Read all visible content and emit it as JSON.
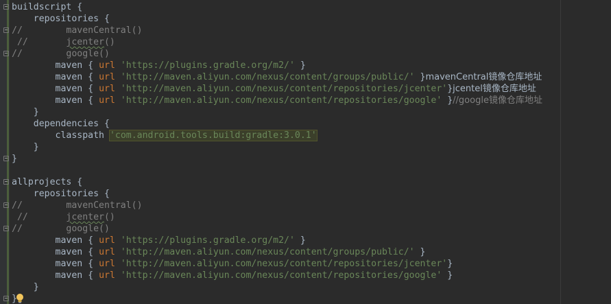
{
  "editor": {
    "language": "gradle",
    "bulb_icon": "lightbulb-icon",
    "lines": [
      {
        "fold": "open",
        "indent": "",
        "tokens": [
          {
            "t": "buildscript {",
            "c": "plain"
          }
        ]
      },
      {
        "fold": "",
        "indent": "    ",
        "tokens": [
          {
            "t": "repositories {",
            "c": "plain"
          }
        ]
      },
      {
        "fold": "open",
        "indent": "",
        "tokens": [
          {
            "t": "//",
            "c": "cm"
          },
          {
            "t": "        mavenCentral()",
            "c": "cm-text"
          }
        ]
      },
      {
        "fold": "",
        "indent": "",
        "tokens": [
          {
            "t": " //",
            "c": "cm"
          },
          {
            "t": "       ",
            "c": "cm-text"
          },
          {
            "t": "jcenter",
            "c": "cm-text wavy"
          },
          {
            "t": "()",
            "c": "cm-text"
          }
        ]
      },
      {
        "fold": "close",
        "indent": "",
        "tokens": [
          {
            "t": "//",
            "c": "cm"
          },
          {
            "t": "        google()",
            "c": "cm-text"
          }
        ]
      },
      {
        "fold": "",
        "indent": "        ",
        "tokens": [
          {
            "t": "maven { ",
            "c": "plain"
          },
          {
            "t": "url",
            "c": "kw"
          },
          {
            "t": " ",
            "c": "plain"
          },
          {
            "t": "'https://plugins.gradle.org/m2/'",
            "c": "str"
          },
          {
            "t": " }",
            "c": "plain"
          }
        ]
      },
      {
        "fold": "",
        "indent": "        ",
        "tokens": [
          {
            "t": "maven { ",
            "c": "plain"
          },
          {
            "t": "url",
            "c": "kw"
          },
          {
            "t": " ",
            "c": "plain"
          },
          {
            "t": "'http://maven.aliyun.com/nexus/content/groups/public/'",
            "c": "str"
          },
          {
            "t": " }",
            "c": "plain"
          },
          {
            "t": "mavenCentral镜像仓库地址",
            "c": "zh"
          }
        ]
      },
      {
        "fold": "",
        "indent": "        ",
        "tokens": [
          {
            "t": "maven { ",
            "c": "plain"
          },
          {
            "t": "url",
            "c": "kw"
          },
          {
            "t": " ",
            "c": "plain"
          },
          {
            "t": "'http://maven.aliyun.com/nexus/content/repositories/jcenter'",
            "c": "str"
          },
          {
            "t": "}",
            "c": "plain"
          },
          {
            "t": "jcentel镜像仓库地址",
            "c": "zh"
          }
        ]
      },
      {
        "fold": "",
        "indent": "        ",
        "tokens": [
          {
            "t": "maven { ",
            "c": "plain"
          },
          {
            "t": "url",
            "c": "kw"
          },
          {
            "t": " ",
            "c": "plain"
          },
          {
            "t": "'http://maven.aliyun.com/nexus/content/repositories/google'",
            "c": "str"
          },
          {
            "t": " }",
            "c": "plain"
          },
          {
            "t": "//google镜像仓库地址",
            "c": "zh-cm"
          }
        ]
      },
      {
        "fold": "",
        "indent": "    ",
        "tokens": [
          {
            "t": "}",
            "c": "plain"
          }
        ]
      },
      {
        "fold": "",
        "indent": "    ",
        "tokens": [
          {
            "t": "dependencies {",
            "c": "plain"
          }
        ]
      },
      {
        "fold": "",
        "indent": "        ",
        "tokens": [
          {
            "t": "classpath ",
            "c": "plain"
          },
          {
            "t": "'com.android.tools.build:gradle:3.0.1'",
            "c": "str-hl"
          }
        ]
      },
      {
        "fold": "",
        "indent": "    ",
        "tokens": [
          {
            "t": "}",
            "c": "plain"
          }
        ]
      },
      {
        "fold": "close",
        "indent": "",
        "tokens": [
          {
            "t": "}",
            "c": "plain"
          }
        ]
      },
      {
        "fold": "",
        "indent": "",
        "tokens": []
      },
      {
        "fold": "open",
        "indent": "",
        "tokens": [
          {
            "t": "allprojects {",
            "c": "plain"
          }
        ]
      },
      {
        "fold": "",
        "indent": "    ",
        "tokens": [
          {
            "t": "repositories {",
            "c": "plain"
          }
        ]
      },
      {
        "fold": "open",
        "indent": "",
        "tokens": [
          {
            "t": "//",
            "c": "cm"
          },
          {
            "t": "        mavenCentral()",
            "c": "cm-text"
          }
        ]
      },
      {
        "fold": "",
        "indent": "",
        "tokens": [
          {
            "t": " //",
            "c": "cm"
          },
          {
            "t": "       ",
            "c": "cm-text"
          },
          {
            "t": "jcenter",
            "c": "cm-text wavy"
          },
          {
            "t": "()",
            "c": "cm-text"
          }
        ]
      },
      {
        "fold": "close",
        "indent": "",
        "tokens": [
          {
            "t": "//",
            "c": "cm"
          },
          {
            "t": "        google()",
            "c": "cm-text"
          }
        ]
      },
      {
        "fold": "",
        "indent": "        ",
        "tokens": [
          {
            "t": "maven { ",
            "c": "plain"
          },
          {
            "t": "url",
            "c": "kw"
          },
          {
            "t": " ",
            "c": "plain"
          },
          {
            "t": "'https://plugins.gradle.org/m2/'",
            "c": "str"
          },
          {
            "t": " }",
            "c": "plain"
          }
        ]
      },
      {
        "fold": "",
        "indent": "        ",
        "tokens": [
          {
            "t": "maven { ",
            "c": "plain"
          },
          {
            "t": "url",
            "c": "kw"
          },
          {
            "t": " ",
            "c": "plain"
          },
          {
            "t": "'http://maven.aliyun.com/nexus/content/groups/public/'",
            "c": "str"
          },
          {
            "t": " }",
            "c": "plain"
          }
        ]
      },
      {
        "fold": "",
        "indent": "        ",
        "tokens": [
          {
            "t": "maven { ",
            "c": "plain"
          },
          {
            "t": "url",
            "c": "kw"
          },
          {
            "t": " ",
            "c": "plain"
          },
          {
            "t": "'http://maven.aliyun.com/nexus/content/repositories/jcenter'",
            "c": "str"
          },
          {
            "t": "}",
            "c": "plain"
          }
        ]
      },
      {
        "fold": "",
        "indent": "        ",
        "tokens": [
          {
            "t": "maven { ",
            "c": "plain"
          },
          {
            "t": "url",
            "c": "kw"
          },
          {
            "t": " ",
            "c": "plain"
          },
          {
            "t": "'http://maven.aliyun.com/nexus/content/repositories/google'",
            "c": "str"
          },
          {
            "t": " }",
            "c": "plain"
          }
        ]
      },
      {
        "fold": "",
        "indent": "    ",
        "tokens": [
          {
            "t": "}",
            "c": "plain"
          }
        ]
      },
      {
        "fold": "close",
        "indent": "",
        "tokens": [
          {
            "t": "}",
            "c": "plain"
          }
        ]
      }
    ]
  },
  "colors": {
    "background": "#2b2b2b",
    "text": "#a9b7c6",
    "keyword": "#cc7832",
    "string": "#6a8759",
    "comment": "#808080"
  }
}
